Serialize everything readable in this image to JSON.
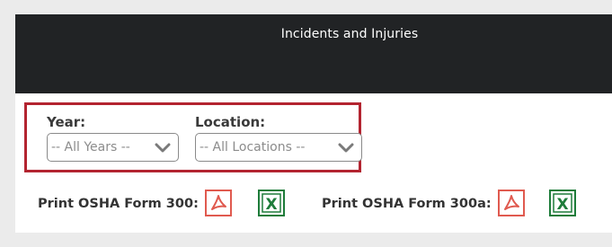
{
  "header": {
    "title": "Incidents and Injuries"
  },
  "filters": {
    "year": {
      "label": "Year:",
      "selected": "-- All Years --"
    },
    "location": {
      "label": "Location:",
      "selected": "-- All Locations --"
    }
  },
  "print": {
    "form300_label": "Print OSHA Form 300:",
    "form300a_label": "Print OSHA Form 300a:",
    "pdf_icon": "pdf-icon",
    "excel_icon": "excel-icon",
    "excel_letter": "X"
  },
  "colors": {
    "header_bg": "#212325",
    "highlight_border": "#b32430",
    "pdf_red": "#e05a4f",
    "excel_green": "#1e7c3a"
  }
}
